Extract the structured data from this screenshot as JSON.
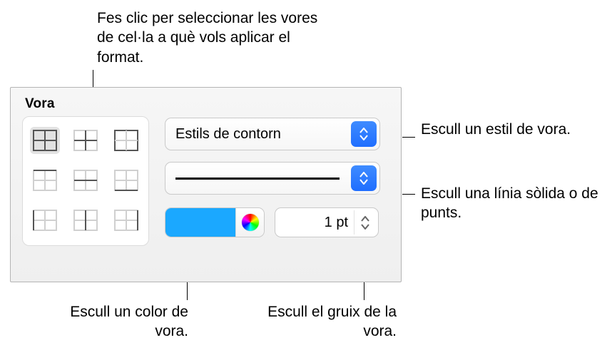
{
  "callouts": {
    "top": "Fes clic per seleccionar les vores de cel·la a què vols aplicar el format.",
    "style": "Escull un estil de vora.",
    "line": "Escull una línia sòlida o de punts.",
    "color": "Escull un color de vora.",
    "thickness": "Escull el gruix de la vora."
  },
  "panel": {
    "title": "Vora",
    "border_style_label": "Estils de contorn",
    "thickness_value": "1 pt",
    "color_hex": "#1ba8ff"
  }
}
